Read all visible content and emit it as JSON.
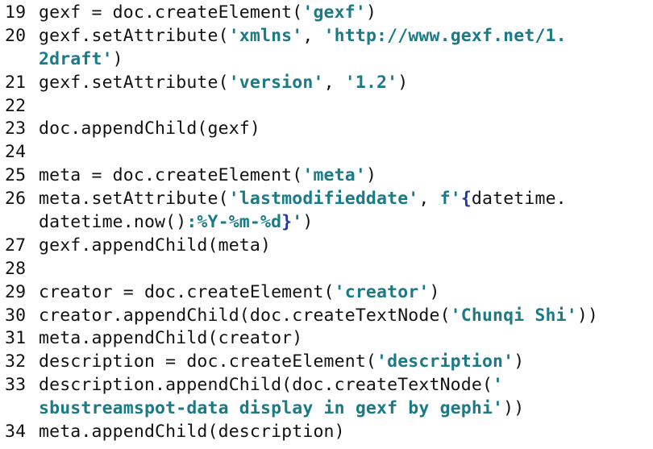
{
  "editor": {
    "lines": [
      {
        "number": "19",
        "text": [
          "gexf = doc.createElement(",
          {
            "s": "'gexf'"
          },
          ")"
        ]
      },
      {
        "number": "20",
        "text": [
          "gexf.setAttribute(",
          {
            "s": "'xmlns'"
          },
          ", ",
          {
            "s": "'http://www.gexf.net/1."
          }
        ]
      },
      {
        "number": "",
        "text": [
          {
            "s": "2draft'"
          },
          ")"
        ]
      },
      {
        "number": "21",
        "text": [
          "gexf.setAttribute(",
          {
            "s": "'version'"
          },
          ", ",
          {
            "s": "'1.2'"
          },
          ")"
        ]
      },
      {
        "number": "22",
        "text": []
      },
      {
        "number": "23",
        "text": [
          "doc.appendChild(gexf)"
        ]
      },
      {
        "number": "24",
        "text": []
      },
      {
        "number": "25",
        "text": [
          "meta = doc.createElement(",
          {
            "s": "'meta'"
          },
          ")"
        ]
      },
      {
        "number": "26",
        "text": [
          "meta.setAttribute(",
          {
            "s": "'lastmodifieddate'"
          },
          ", ",
          {
            "s": "f'"
          },
          {
            "b": "{"
          },
          "datetime."
        ]
      },
      {
        "number": "",
        "text": [
          "datetime.now()",
          {
            "s": ":%Y-%m-%d"
          },
          {
            "b": "}"
          },
          {
            "s": "'"
          },
          ")"
        ]
      },
      {
        "number": "27",
        "text": [
          "gexf.appendChild(meta)"
        ]
      },
      {
        "number": "28",
        "text": []
      },
      {
        "number": "29",
        "text": [
          "creator = doc.createElement(",
          {
            "s": "'creator'"
          },
          ")"
        ]
      },
      {
        "number": "30",
        "text": [
          "creator.appendChild(doc.createTextNode(",
          {
            "s": "'Chunqi Shi'"
          },
          "))"
        ]
      },
      {
        "number": "31",
        "text": [
          "meta.appendChild(creator)"
        ]
      },
      {
        "number": "32",
        "text": [
          "description = doc.createElement(",
          {
            "s": "'description'"
          },
          ")"
        ]
      },
      {
        "number": "33",
        "text": [
          "description.appendChild(doc.createTextNode(",
          {
            "s": "'"
          }
        ]
      },
      {
        "number": "",
        "text": [
          {
            "s": "sbustreamspot-data display in gexf by gephi'"
          },
          "))"
        ]
      },
      {
        "number": "34",
        "text": [
          "meta.appendChild(description)"
        ]
      }
    ]
  },
  "colors": {
    "background": "#ffffff",
    "text": "#111111",
    "string": "#1a7a86",
    "brace": "#1f3a9e"
  }
}
